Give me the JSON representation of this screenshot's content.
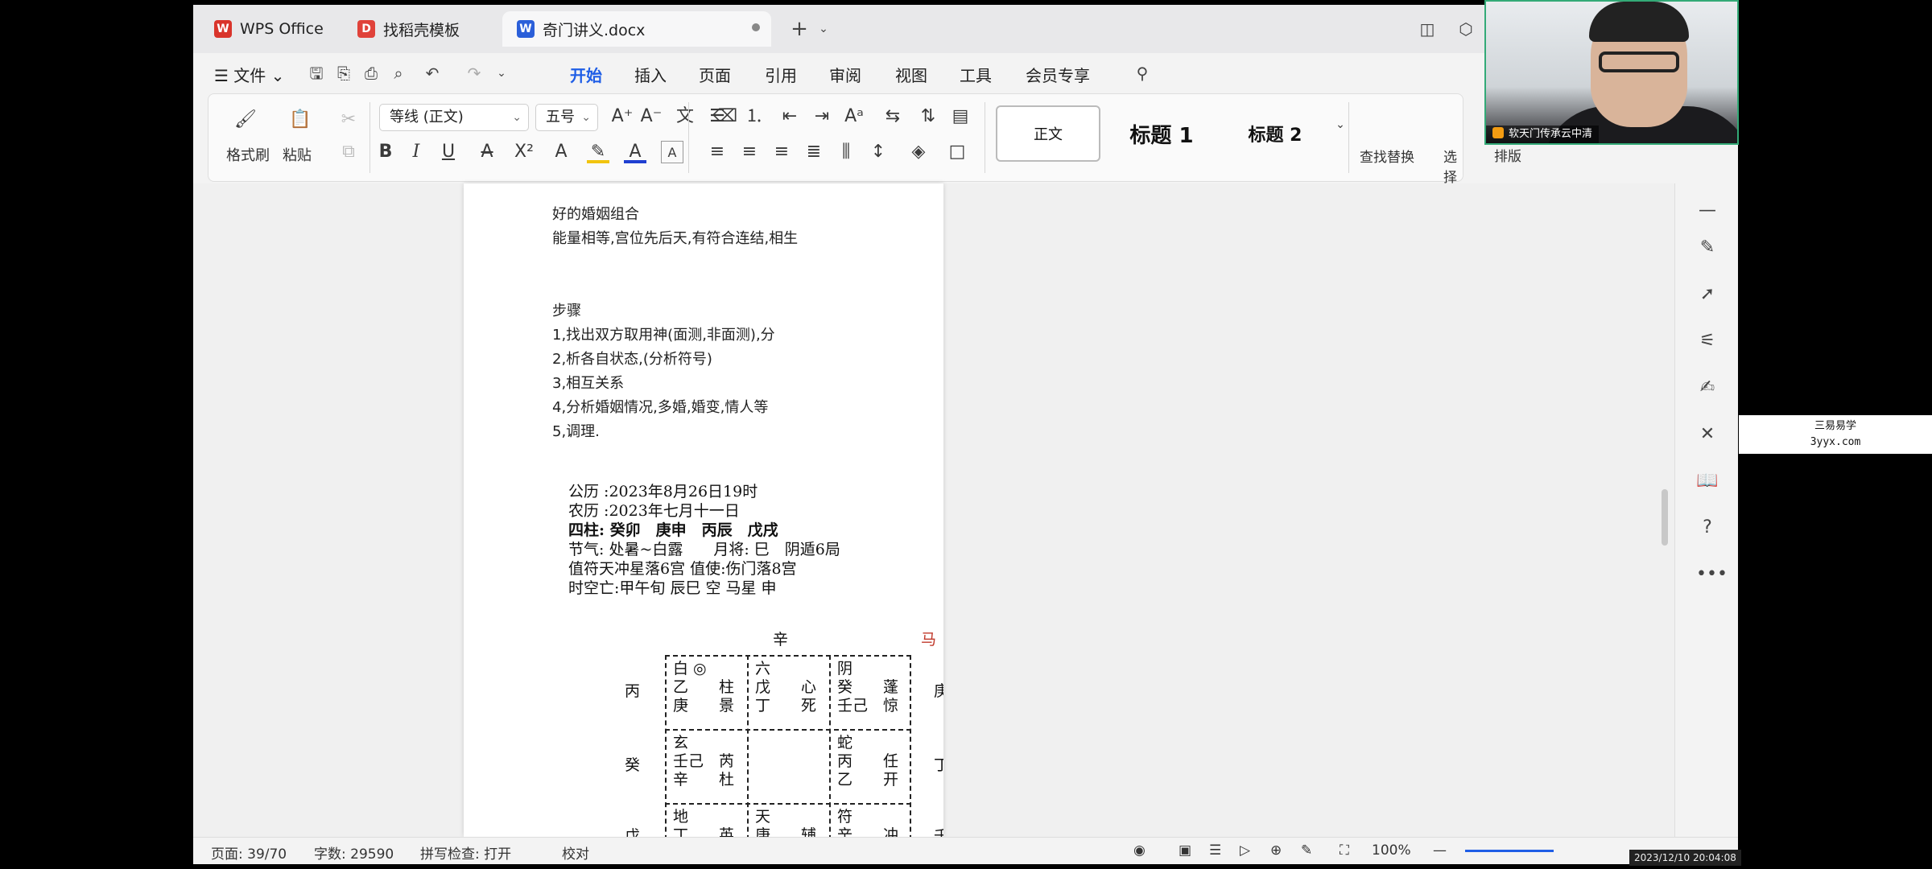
{
  "tabs": [
    {
      "label": "WPS Office",
      "icon": "wps-logo-icon",
      "color": "#d9342b"
    },
    {
      "label": "找稻壳模板",
      "icon": "docer-icon",
      "color": "#e0423a"
    },
    {
      "label": "奇门讲义.docx",
      "icon": "word-doc-icon",
      "color": "#2b5fd9"
    }
  ],
  "menu": {
    "file_label": "文件",
    "items": [
      "开始",
      "插入",
      "页面",
      "引用",
      "审阅",
      "视图",
      "工具",
      "会员专享"
    ],
    "active": "开始"
  },
  "ribbon": {
    "format_painter": "格式刷",
    "paste": "粘贴",
    "font_name": "等线 (正文)",
    "font_size": "五号",
    "styles": [
      "正文",
      "标题 1",
      "标题 2"
    ],
    "find_replace": "查找替换",
    "select": "选择",
    "arrange": "排版"
  },
  "document": {
    "lines": [
      "好的婚姻组合",
      "能量相等,宫位先后天,有符合连结,相生",
      "步骤",
      "1,找出双方取用神(面测,非面测),分",
      "2,析各自状态,(分析符号)",
      "3,相互关系",
      "4,分析婚姻情况,多婚,婚变,情人等",
      "5,调理."
    ],
    "info": {
      "gongli": "公历 :2023年8月26日19时",
      "nongli": "农历 :2023年七月十一日",
      "sizhu_label": "四柱:",
      "sizhu": "癸卯　庚申　丙辰　戊戌",
      "jieqi": "节气: 处暑~白露　　月将: 巳　阴遁6局",
      "zhifu": "值符天冲星落6宫 值使:伤门落8宫",
      "kongwang": "时空亡:甲午旬 辰巳 空 马星 申"
    },
    "pan": {
      "top_label": "辛",
      "ma_label": "马",
      "left_labels": [
        "丙",
        "癸",
        "戊"
      ],
      "right_labels": [
        "庚",
        "丁",
        "壬己"
      ],
      "cells": {
        "c11": [
          "白 ◎",
          "乙　　柱",
          "庚　　景"
        ],
        "c12": [
          "六",
          "戊　　心",
          "丁　　死"
        ],
        "c13": [
          "阴",
          "癸　　蓬",
          "壬己　惊"
        ],
        "c21": [
          "玄",
          "壬己　芮",
          "辛　　杜"
        ],
        "c23": [
          "蛇",
          "丙　　任",
          "乙　　开"
        ],
        "c31": [
          "地",
          "丁　　英"
        ],
        "c32": [
          "天",
          "庚　　辅"
        ],
        "c33": [
          "符",
          "辛　　冲"
        ]
      }
    }
  },
  "status": {
    "page": "页面: 39/70",
    "words": "字数: 29590",
    "spell": "拼写检查: 打开",
    "proof": "校对",
    "zoom": "100%"
  },
  "webcam_label": "软天门传承云中清",
  "watermark": {
    "line1": "三易易学",
    "line2": "3yyx.com"
  },
  "timestamp": "2023/12/10 20:04:08"
}
